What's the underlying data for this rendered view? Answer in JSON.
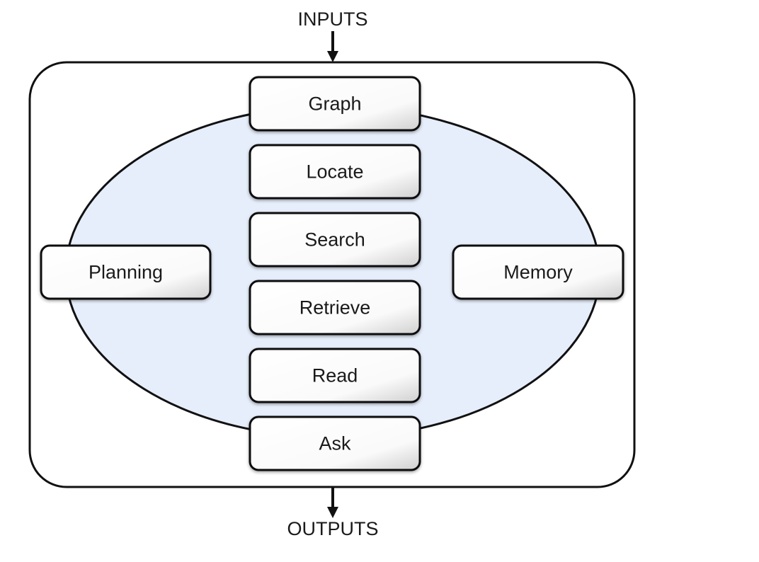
{
  "inputs_label": "INPUTS",
  "outputs_label": "OUTPUTS",
  "center_modules": [
    "Graph",
    "Locate",
    "Search",
    "Retrieve",
    "Read",
    "Ask"
  ],
  "left_module": "Planning",
  "right_module": "Memory",
  "colors": {
    "ellipse_fill": "#e6eefb",
    "stroke": "#111111",
    "box_fill_light": "#ffffff",
    "box_fill_dark": "#d8d8d8"
  }
}
